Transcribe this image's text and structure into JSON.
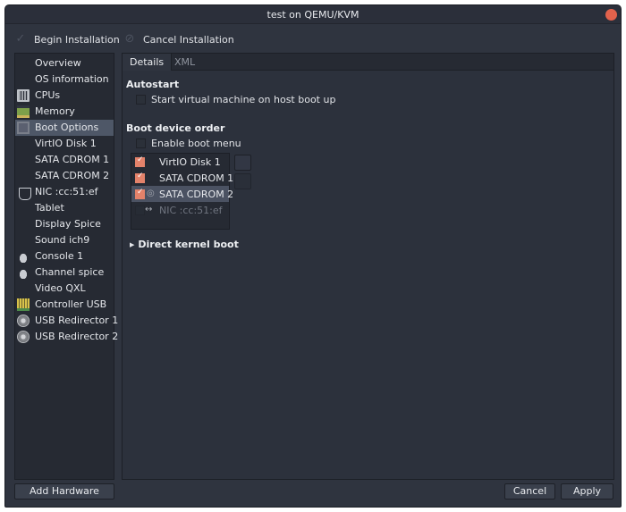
{
  "window": {
    "title": "test on QEMU/KVM"
  },
  "toolbar": {
    "begin_label": "Begin Installation",
    "cancel_label": "Cancel Installation"
  },
  "sidebar": {
    "items": [
      {
        "label": "Overview",
        "icon": ""
      },
      {
        "label": "OS information",
        "icon": ""
      },
      {
        "label": "CPUs",
        "icon": "cpu-icon"
      },
      {
        "label": "Memory",
        "icon": "memory-icon"
      },
      {
        "label": "Boot Options",
        "icon": "boot-icon"
      },
      {
        "label": "VirtIO Disk 1",
        "icon": ""
      },
      {
        "label": "SATA CDROM 1",
        "icon": ""
      },
      {
        "label": "SATA CDROM 2",
        "icon": ""
      },
      {
        "label": "NIC :cc:51:ef",
        "icon": "nic-icon"
      },
      {
        "label": "Tablet",
        "icon": ""
      },
      {
        "label": "Display Spice",
        "icon": ""
      },
      {
        "label": "Sound ich9",
        "icon": ""
      },
      {
        "label": "Console 1",
        "icon": "console-icon"
      },
      {
        "label": "Channel spice",
        "icon": "channel-icon"
      },
      {
        "label": "Video QXL",
        "icon": ""
      },
      {
        "label": "Controller USB",
        "icon": "controller-icon"
      },
      {
        "label": "USB Redirector 1",
        "icon": "usb-icon"
      },
      {
        "label": "USB Redirector 2",
        "icon": "usb-icon"
      }
    ],
    "selected": "Boot Options",
    "add_hardware_label": "Add Hardware"
  },
  "tabs": [
    {
      "label": "Details"
    },
    {
      "label": "XML"
    }
  ],
  "autostart": {
    "title": "Autostart",
    "checkbox_label": "Start virtual machine on host boot up",
    "checked": false
  },
  "boot": {
    "title": "Boot device order",
    "enable_menu_label": "Enable boot menu",
    "enable_menu_checked": false,
    "devices": [
      {
        "label": "VirtIO Disk 1",
        "checked": true
      },
      {
        "label": "SATA CDROM 1",
        "checked": true
      },
      {
        "label": "SATA CDROM 2",
        "checked": true
      },
      {
        "label": "NIC :cc:51:ef",
        "checked": false
      }
    ]
  },
  "kernel": {
    "title": "Direct kernel boot",
    "expanded": false
  },
  "footer": {
    "cancel_label": "Cancel",
    "apply_label": "Apply"
  },
  "colors": {
    "accent": "#e3826a",
    "selection": "#4e5767",
    "background": "#2f343f"
  }
}
